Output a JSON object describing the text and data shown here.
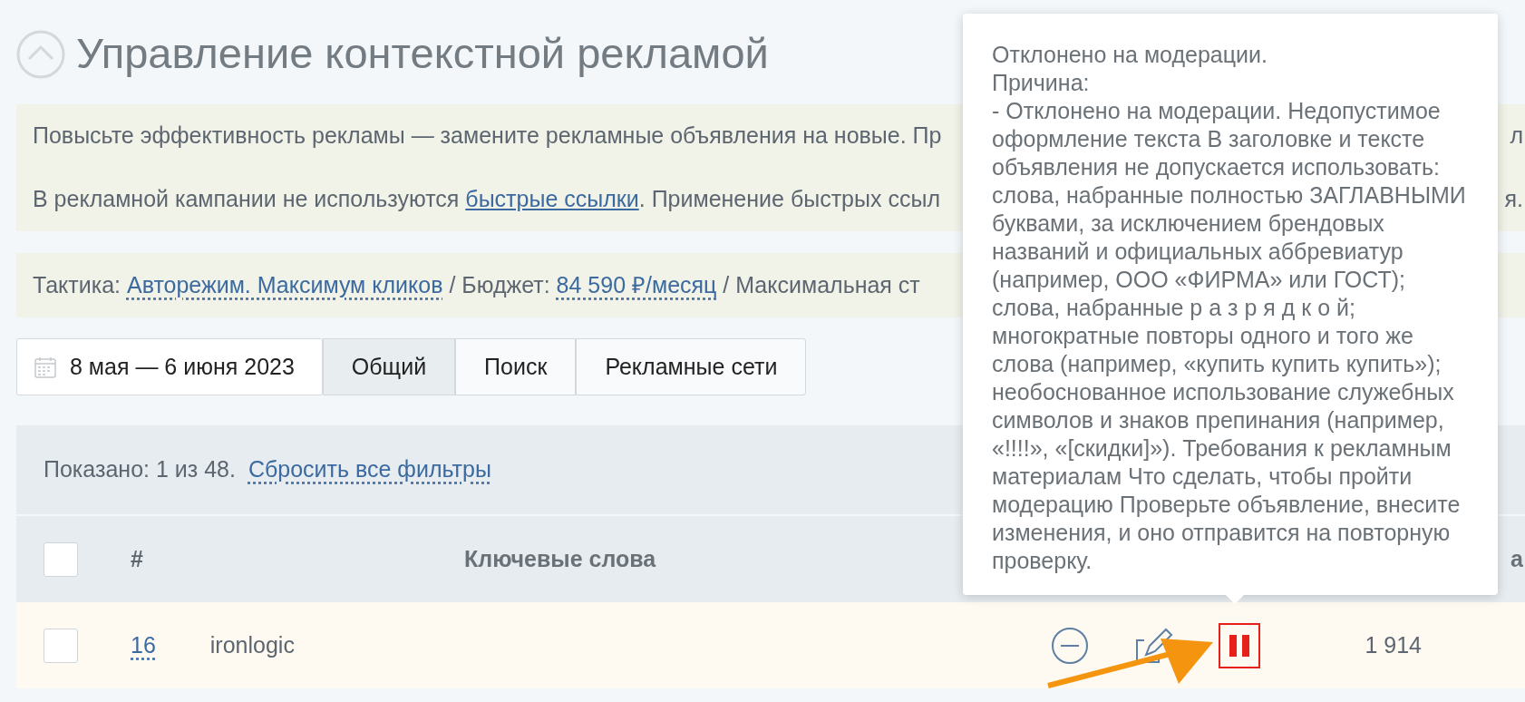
{
  "page": {
    "title": "Управление контекстной рекламой"
  },
  "notices": [
    {
      "parts": [
        {
          "text": "Повысьте эффективность рекламы — замените рекламные объявления на новые. Пр",
          "link": false
        }
      ],
      "right_fragment": "л"
    },
    {
      "parts": [
        {
          "text": "В рекламной кампании не используются ",
          "link": false
        },
        {
          "text": "быстрые ссылки",
          "link": true
        },
        {
          "text": ". Применение быстрых ссыл",
          "link": false
        }
      ],
      "right_fragment": "я."
    }
  ],
  "strategy": {
    "parts": [
      {
        "text": "Тактика: ",
        "link": false
      },
      {
        "text": "Авторежим. Максимум кликов",
        "link": true
      },
      {
        "text": " / Бюджет: ",
        "link": false
      },
      {
        "text": "84 590 ₽/месяц",
        "link": true
      },
      {
        "text": " / Максимальная ст",
        "link": false
      }
    ]
  },
  "date_range": "8 мая — 6 июня 2023",
  "tabs": [
    {
      "label": "Общий",
      "selected": true
    },
    {
      "label": "Поиск",
      "selected": false
    },
    {
      "label": "Рекламные сети",
      "selected": false
    }
  ],
  "filter": {
    "shown": "Показано: 1 из 48.",
    "reset_link": "Сбросить все фильтры"
  },
  "table": {
    "header_checked": false,
    "columns": [
      "#",
      "Ключевые слова",
      "а"
    ],
    "rows": [
      {
        "checked": false,
        "number": "16",
        "keyword": "ironlogic",
        "paused": true,
        "value": "1 914"
      }
    ]
  },
  "popover": {
    "lines": [
      "Отклонено на модерации.",
      "Причина:",
      "- Отклонено на модерации. Недопустимое оформление текста В заголовке и тексте объявления не допускается использовать: слова, набранные полностью ЗАГЛАВНЫМИ буквами, за исключением брендовых названий и официальных аббревиатур (например, ООО «ФИРМА» или ГОСТ); слова, набранные р а з р я д к о й; многократные повторы одного и того же слова (например, «купить купить купить»); необоснованное использование служебных символов и знаков препинания (например, «!!!!», «[скидки]»). Требования к рекламным материалам Что сделать, чтобы пройти модерацию Проверьте объявление, внесите изменения, и оно отправится на повторную проверку."
    ]
  }
}
